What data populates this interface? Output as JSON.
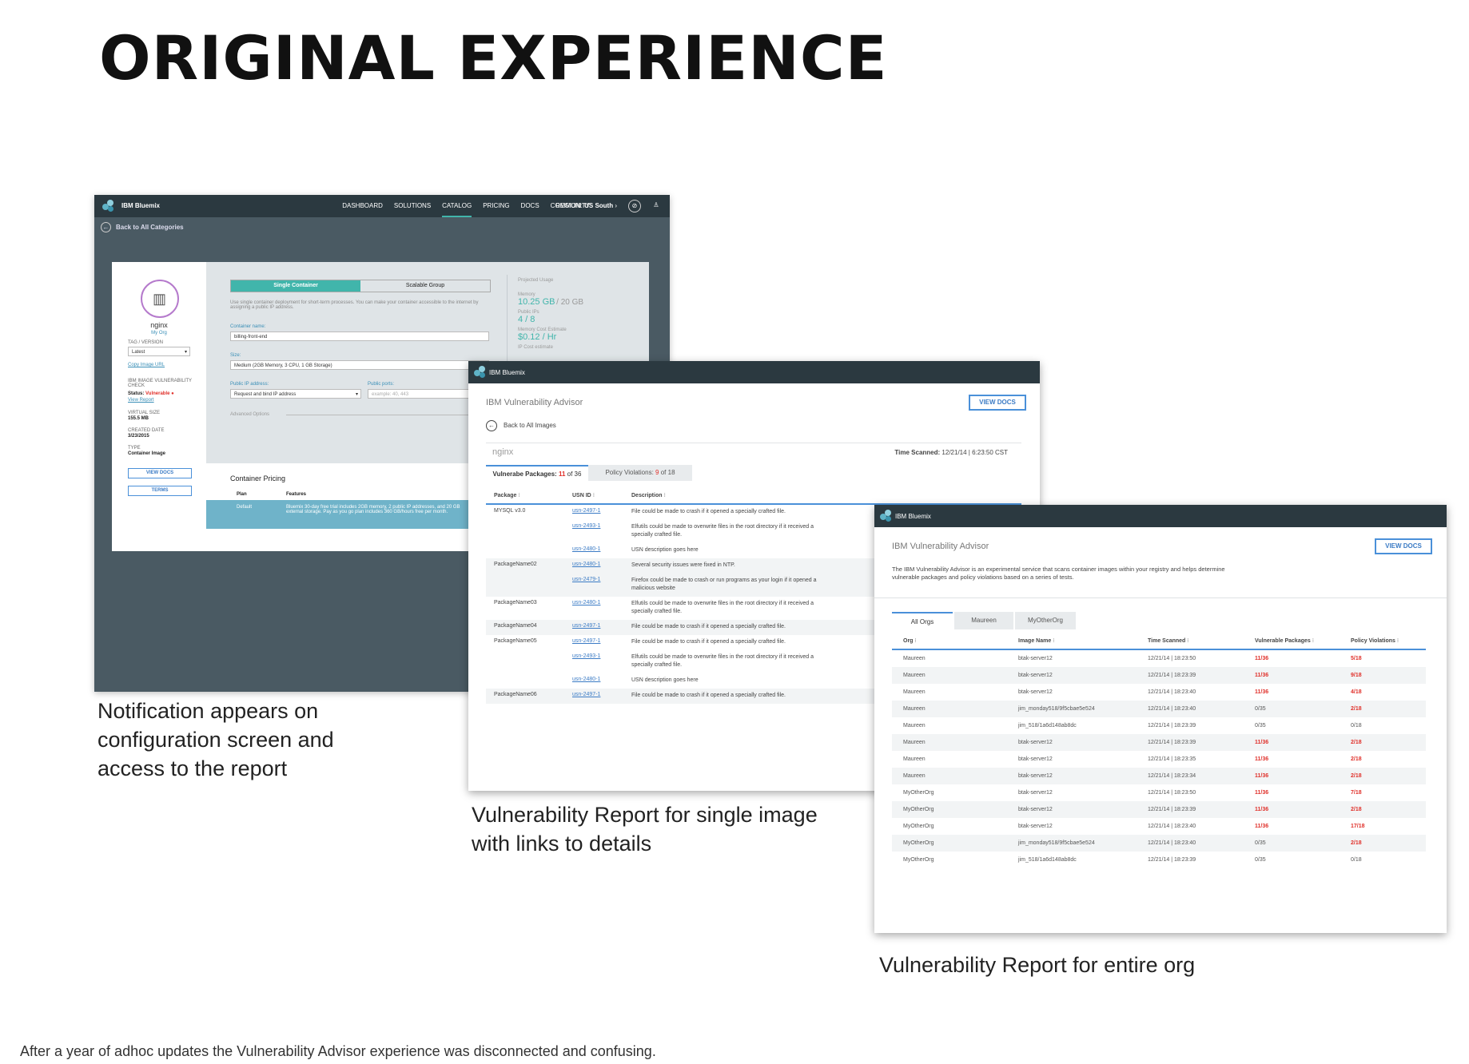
{
  "heading": "ORIGINAL EXPERIENCE",
  "captions": {
    "config": "Notification appears on configuration screen and access to the report",
    "single": "Vulnerability Report for single image with links to details",
    "org": "Vulnerability Report for entire org"
  },
  "footnote": "After a year of adhoc updates the Vulnerability Advisor experience was disconnected and confusing.",
  "brand": "IBM Bluemix",
  "config_screen": {
    "nav": [
      "DASHBOARD",
      "SOLUTIONS",
      "CATALOG",
      "PRICING",
      "DOCS",
      "COMMUNITY"
    ],
    "active_nav": "CATALOG",
    "region_label": "REGION:",
    "region_value": "US South",
    "back": "Back to All Categories",
    "image_name": "nginx",
    "org": "My Org",
    "tag_label": "TAG / VERSION",
    "tag_value": "Latest",
    "copy_url": "Copy Image URL",
    "check_label": "IBM IMAGE VULNERABILITY CHECK",
    "status_label": "Status:",
    "status_value": "Vulnerable",
    "view_report": "View Report",
    "vsize_label": "VIRTUAL SIZE",
    "vsize_value": "155.5 MB",
    "created_label": "CREATED DATE",
    "created_value": "3/23/2015",
    "type_label": "TYPE",
    "type_value": "Container Image",
    "view_docs": "VIEW DOCS",
    "terms": "TERMS",
    "seg_single": "Single Container",
    "seg_group": "Scalable Group",
    "desc": "Use single container deployment for short-term processes. You can make your container accessible to the internet by assigning a public IP address.",
    "container_name_label": "Container name:",
    "container_name_value": "billing-front-end",
    "size_label": "Size:",
    "size_value": "Medium (2GB Memory, 3 CPU, 1 GB Storage)",
    "ip_label": "Public IP address:",
    "ip_value": "Request and bind IP address",
    "ports_label": "Public ports:",
    "ports_placeholder": "example: 40, 443",
    "advanced": "Advanced Options",
    "usage_title": "Projected Usage",
    "memory_label": "Memory",
    "memory_value": "10.25 GB",
    "memory_total": "/ 20 GB",
    "ips_label": "Public IPs",
    "ips_value": "4 / 8",
    "cost_label": "Memory Cost Estimate",
    "cost_value": "$0.12 / Hr",
    "ip_cost_label": "IP Cost estimate",
    "pricing_title": "Container Pricing",
    "plan_col": "Plan",
    "features_col": "Features",
    "plan_value": "Default",
    "plan_desc": "Bluemix 30-day free trial includes 2GB memory, 2 public IP addresses, and 20 GB external storage. Pay as you go plan includes 360 GB/hours free per month."
  },
  "single_report": {
    "title": "IBM Vulnerability Advisor",
    "view_docs": "VIEW DOCS",
    "back": "Back to All Images",
    "image": "nginx",
    "scanned_label": "Time Scanned:",
    "scanned_value": "12/21/14 | 6:23:50 CST",
    "tab_vuln_label": "Vulnerabe Packages:",
    "tab_vuln_count": "11",
    "tab_vuln_total": "of 36",
    "tab_policy_label": "Policy Violations:",
    "tab_policy_count": "9",
    "tab_policy_total": "of 18",
    "columns": [
      "Package",
      "USN ID",
      "Description"
    ],
    "rows": [
      {
        "pkg": "MYSQL v3.0",
        "usn": "usn-2497-1",
        "desc": "File could be made to crash if it opened a specially crafted file.",
        "h": 19,
        "alt": false
      },
      {
        "pkg": "",
        "usn": "usn-2493-1",
        "desc": "Elfutils could be made to overwrite files in the root directory if it received a specially crafted file.",
        "h": 29,
        "alt": false
      },
      {
        "pkg": "",
        "usn": "usn-2480-1",
        "desc": "USN description goes here",
        "h": 19,
        "alt": false
      },
      {
        "pkg": "PackageName02",
        "usn": "usn-2480-1",
        "desc": "Several security issues were fixed in NTP.",
        "h": 19,
        "alt": true
      },
      {
        "pkg": "",
        "usn": "usn-2479-1",
        "desc": "Firefox could be made to crash or run programs as your login if it opened a malicious website",
        "h": 29,
        "alt": true
      },
      {
        "pkg": "PackageName03",
        "usn": "usn-2480-1",
        "desc": "Elfutils could be made to overwrite files in the root directory if it received a specially crafted file.",
        "h": 29,
        "alt": false
      },
      {
        "pkg": "PackageName04",
        "usn": "usn-2497-1",
        "desc": "File could be made to crash if it opened a specially crafted file.",
        "h": 19,
        "alt": true
      },
      {
        "pkg": "PackageName05",
        "usn": "usn-2497-1",
        "desc": "File could be made to crash if it opened a specially crafted file.",
        "h": 19,
        "alt": false
      },
      {
        "pkg": "",
        "usn": "usn-2493-1",
        "desc": "Elfutils could be made to overwrite files in the root directory if it received a specially crafted file.",
        "h": 29,
        "alt": false
      },
      {
        "pkg": "",
        "usn": "usn-2480-1",
        "desc": "USN description goes here",
        "h": 19,
        "alt": false
      },
      {
        "pkg": "PackageName06",
        "usn": "usn-2497-1",
        "desc": "File could be made to crash if it opened a specially crafted file.",
        "h": 19,
        "alt": true
      }
    ]
  },
  "org_report": {
    "title": "IBM Vulnerability Advisor",
    "view_docs": "VIEW DOCS",
    "intro": "The IBM Vulnerability Advisor is an experimental service that scans container images within your registry and helps determine vulnerable packages and policy violations based on a series of tests.",
    "tabs": [
      "All Orgs",
      "Maureen",
      "MyOtherOrg"
    ],
    "columns": [
      "Org",
      "Image Name",
      "Time Scanned",
      "Vulnerable Packages",
      "Policy Violations"
    ],
    "rows": [
      [
        "Maureen",
        "btak-server12",
        "12/21/14 | 18:23:50",
        "11/36",
        "5/18"
      ],
      [
        "Maureen",
        "btak-server12",
        "12/21/14 | 18:23:39",
        "11/36",
        "9/18"
      ],
      [
        "Maureen",
        "btak-server12",
        "12/21/14 | 18:23:40",
        "11/36",
        "4/18"
      ],
      [
        "Maureen",
        "jim_monday518/9f5cbae5e524",
        "12/21/14 | 18:23:40",
        "0/35",
        "2/18"
      ],
      [
        "Maureen",
        "jim_518/1a6d148ab8dc",
        "12/21/14 | 18:23:39",
        "0/35",
        "0/18"
      ],
      [
        "Maureen",
        "btak-server12",
        "12/21/14 | 18:23:39",
        "11/36",
        "2/18"
      ],
      [
        "Maureen",
        "btak-server12",
        "12/21/14 | 18:23:35",
        "11/36",
        "2/18"
      ],
      [
        "Maureen",
        "btak-server12",
        "12/21/14 | 18:23:34",
        "11/36",
        "2/18"
      ],
      [
        "MyOtherOrg",
        "btak-server12",
        "12/21/14 | 18:23:50",
        "11/36",
        "7/18"
      ],
      [
        "MyOtherOrg",
        "btak-server12",
        "12/21/14 | 18:23:39",
        "11/36",
        "2/18"
      ],
      [
        "MyOtherOrg",
        "btak-server12",
        "12/21/14 | 18:23:40",
        "11/36",
        "17/18"
      ],
      [
        "MyOtherOrg",
        "jim_monday518/9f5cbae5e524",
        "12/21/14 | 18:23:40",
        "0/35",
        "2/18"
      ],
      [
        "MyOtherOrg",
        "jim_518/1a6d148ab8dc",
        "12/21/14 | 18:23:39",
        "0/35",
        "0/18"
      ]
    ]
  },
  "colors": {
    "accent": "#41b5ab",
    "link": "#3b7bc5",
    "danger": "#e0302a",
    "header": "#2b3940"
  }
}
